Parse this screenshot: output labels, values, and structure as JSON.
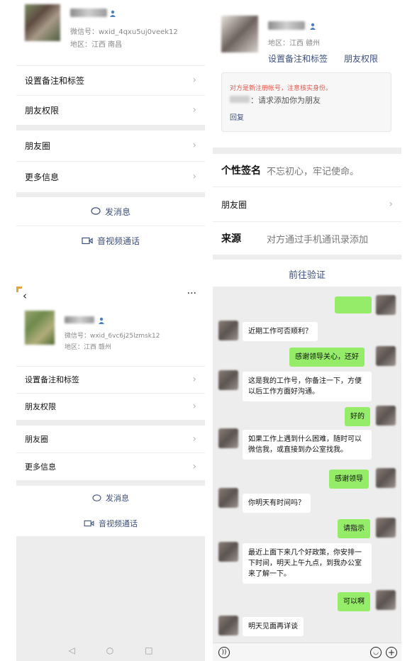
{
  "profile_top": {
    "wechat_id": "微信号：wxid_4qxu5uj0veek12",
    "region": "地区：江西  南昌",
    "remark_tag": "设置备注和标签",
    "friend_perm": "朋友权限",
    "moments": "朋友圈",
    "more_info": "更多信息",
    "send_msg": "发消息",
    "av_call": "音视频通话"
  },
  "profile_new": {
    "region": "地区：江西  赣州",
    "remark_tag": "设置备注和标签",
    "friend_perm": "朋友权限",
    "warning": "对方是新注册帐号，注意核实身份。",
    "request": "：请求添加你为朋友",
    "reply": "回复",
    "signature_label": "个性签名",
    "signature_value": "不忘初心，牢记使命。",
    "moments": "朋友圈",
    "source_label": "来源",
    "source_value": "对方通过手机通讯录添加",
    "verify": "前往验证"
  },
  "profile_bottom": {
    "more_icon": "···",
    "wechat_id": "微信号：wxid_6vc6j25lzmsk12",
    "region": "地区：江西  赣州",
    "remark_tag": "设置备注和标签",
    "friend_perm": "朋友权限",
    "moments": "朋友圈",
    "more_info": "更多信息",
    "send_msg": "发消息",
    "av_call": "音视频通话"
  },
  "chat": {
    "messages": [
      {
        "side": "out",
        "text": ""
      },
      {
        "side": "in",
        "text": "近期工作可否顺利？"
      },
      {
        "side": "out",
        "text": "感谢领导关心，还好"
      },
      {
        "side": "in",
        "text": "这是我的工作号，你备注一下，方便以后工作方面好沟通。"
      },
      {
        "side": "out",
        "text": "好的"
      },
      {
        "side": "in",
        "text": "如果工作上遇到什么困难，随时可以微信我，或直接到办公室找我。"
      },
      {
        "side": "out",
        "text": "感谢领导"
      },
      {
        "side": "in",
        "text": "你明天有时间吗？"
      },
      {
        "side": "out",
        "text": "请指示"
      },
      {
        "side": "in",
        "text": "最近上面下来几个好政策，你安排一下时间，明天上午九点，到我办公室来了解一下。"
      },
      {
        "side": "out",
        "text": "可以啊"
      },
      {
        "side": "in",
        "text": "明天见面再详谈"
      }
    ],
    "icons": [
      "voice-icon",
      "emoji-icon",
      "plus-icon"
    ]
  },
  "colors": {
    "link": "#3d4f7c",
    "bubble_out": "#95ec69",
    "warning": "#e05a4d",
    "divider": "#ededed"
  }
}
